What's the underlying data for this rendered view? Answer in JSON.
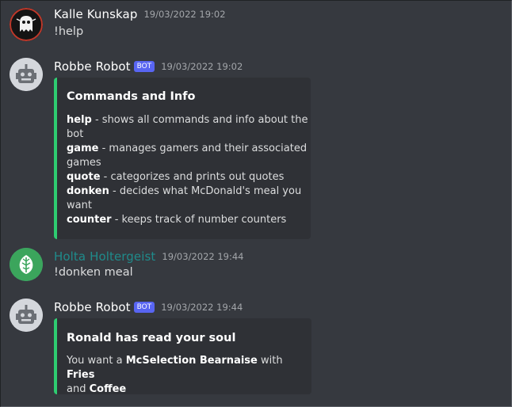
{
  "messages": [
    {
      "username": "Kalle Kunskap",
      "timestamp": "19/03/2022 19:02",
      "content": "!help",
      "avatar_icon": "ghost-icon"
    },
    {
      "username": "Robbe Robot",
      "bot_tag": "BOT",
      "timestamp": "19/03/2022 19:02",
      "avatar_icon": "robot-icon",
      "embed": {
        "color": "#2ecc71",
        "title": "Commands and Info",
        "lines": [
          {
            "cmd": "help",
            "desc": " - shows all commands and info about the"
          },
          {
            "cont": "bot"
          },
          {
            "cmd": "game",
            "desc": " - manages gamers and their associated"
          },
          {
            "cont": "games"
          },
          {
            "cmd": "quote",
            "desc": " - categorizes and prints out quotes"
          },
          {
            "cmd": "donken",
            "desc": " - decides what McDonald's meal you"
          },
          {
            "cont": "want"
          },
          {
            "cmd": "counter",
            "desc": " - keeps track of number counters"
          }
        ]
      }
    },
    {
      "username": "Holta Holtergeist",
      "username_color": "#1f8b8b",
      "timestamp": "19/03/2022 19:44",
      "content": "!donken meal",
      "avatar_icon": "leaf-icon"
    },
    {
      "username": "Robbe Robot",
      "bot_tag": "BOT",
      "timestamp": "19/03/2022 19:44",
      "avatar_icon": "robot-icon",
      "embed": {
        "color": "#2ecc71",
        "title": "Ronald has read your soul",
        "desc": {
          "pre": "You want a ",
          "item1": "McSelection Bearnaise",
          "mid": " with ",
          "item2": "Fries",
          "line2_pre": "and ",
          "item3": "Coffee"
        }
      }
    }
  ]
}
